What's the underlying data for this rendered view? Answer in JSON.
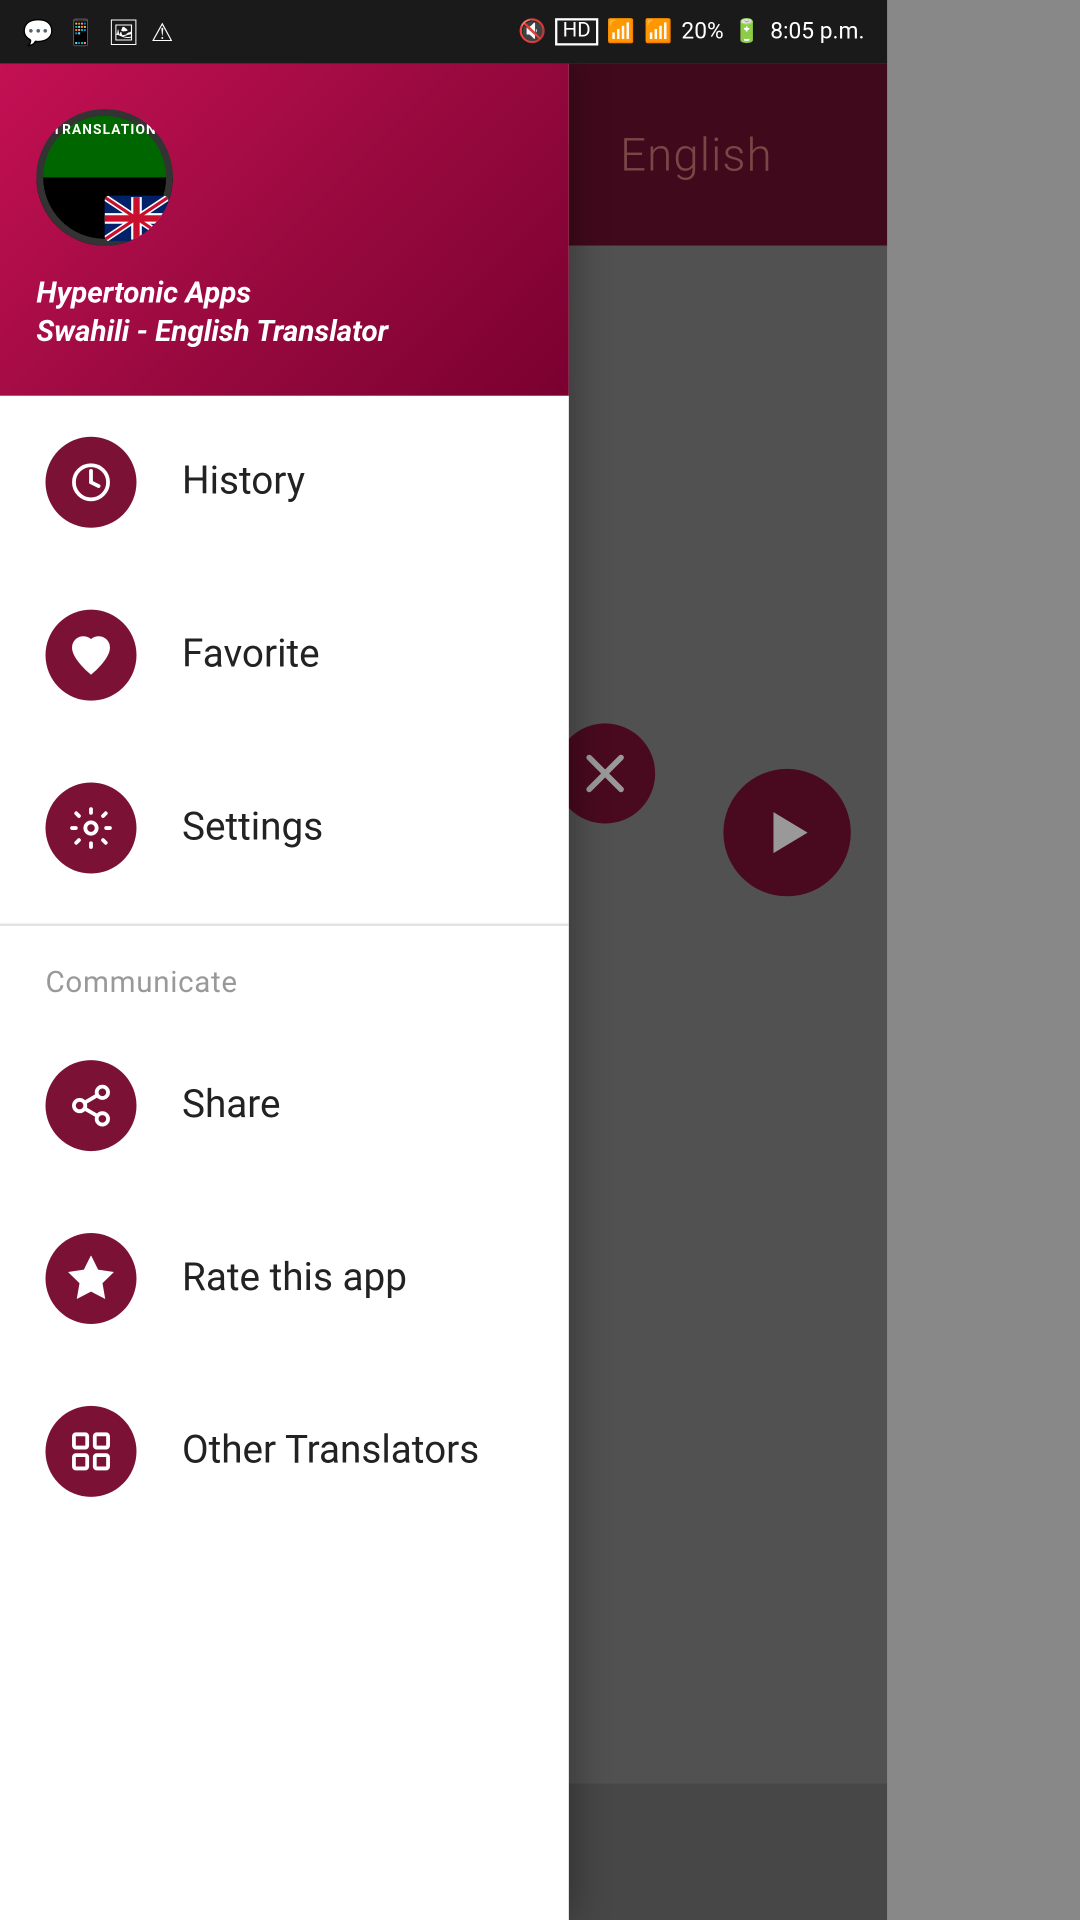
{
  "statusBar": {
    "time": "8:05 p.m.",
    "battery": "20%",
    "signal1": "●●●●",
    "signal2": "●●●●"
  },
  "header": {
    "rightLabel": "English",
    "company": "Hypertonic Apps",
    "appName": "Swahili - English Translator"
  },
  "menu": {
    "items": [
      {
        "id": "history",
        "label": "History",
        "icon": "clock"
      },
      {
        "id": "favorite",
        "label": "Favorite",
        "icon": "heart"
      },
      {
        "id": "settings",
        "label": "Settings",
        "icon": "gear"
      }
    ],
    "sectionLabel": "Communicate",
    "communicateItems": [
      {
        "id": "share",
        "label": "Share",
        "icon": "share"
      },
      {
        "id": "rate",
        "label": "Rate this app",
        "icon": "star"
      },
      {
        "id": "translators",
        "label": "Other Translators",
        "icon": "grid"
      }
    ]
  }
}
